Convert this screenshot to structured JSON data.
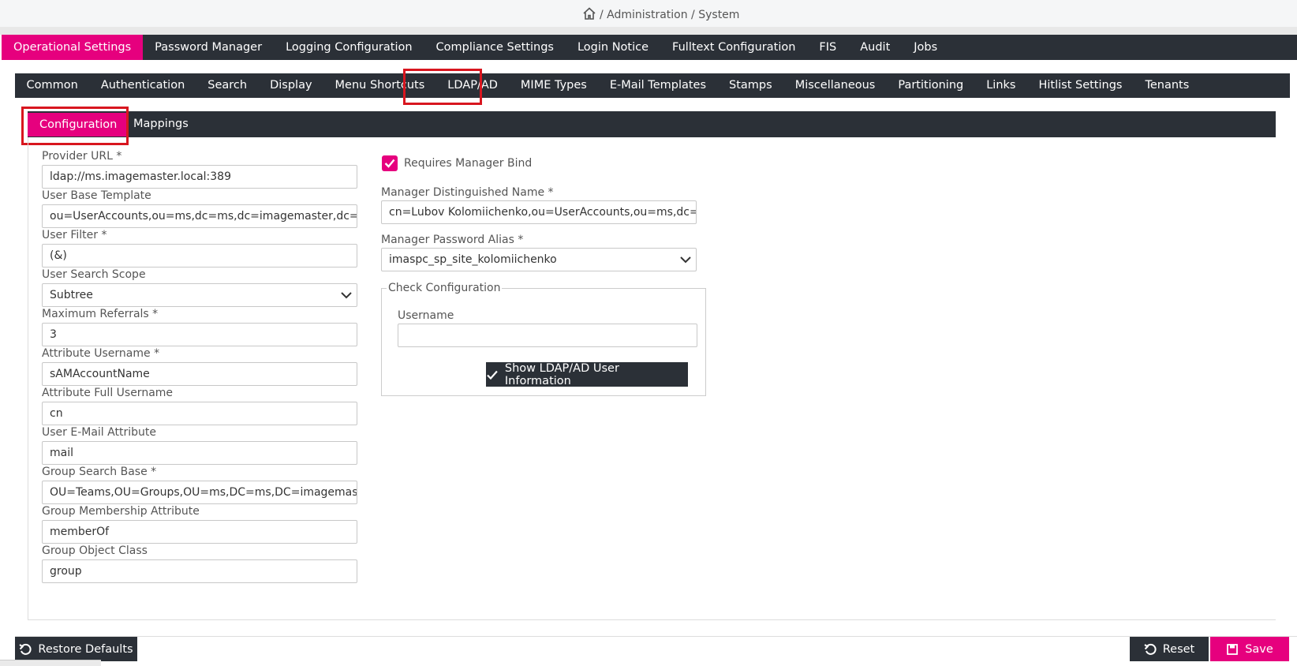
{
  "breadcrumb": {
    "text": "/ Administration / System"
  },
  "nav1": {
    "items": [
      "Operational Settings",
      "Password Manager",
      "Logging Configuration",
      "Compliance Settings",
      "Login Notice",
      "Fulltext Configuration",
      "FIS",
      "Audit",
      "Jobs"
    ]
  },
  "nav2": {
    "items": [
      "Common",
      "Authentication",
      "Search",
      "Display",
      "Menu Shortcuts",
      "LDAP/AD",
      "MIME Types",
      "E-Mail Templates",
      "Stamps",
      "Miscellaneous",
      "Partitioning",
      "Links",
      "Hitlist Settings",
      "Tenants"
    ]
  },
  "nav3": {
    "configuration": "Configuration",
    "mappings": "Mappings"
  },
  "form": {
    "provider_url": {
      "label": "Provider URL  *",
      "value": "ldap://ms.imagemaster.local:389"
    },
    "user_base_template": {
      "label": "User Base Template",
      "value": "ou=UserAccounts,ou=ms,dc=ms,dc=imagemaster,dc=local"
    },
    "user_filter": {
      "label": "User Filter  *",
      "value": "(&)"
    },
    "user_search_scope": {
      "label": "User Search Scope",
      "value": "Subtree"
    },
    "maximum_referrals": {
      "label": "Maximum Referrals  *",
      "value": "3"
    },
    "attribute_username": {
      "label": "Attribute Username  *",
      "value": "sAMAccountName"
    },
    "attribute_full_username": {
      "label": "Attribute Full Username",
      "value": "cn"
    },
    "user_email_attribute": {
      "label": "User E-Mail Attribute",
      "value": "mail"
    },
    "group_search_base": {
      "label": "Group Search Base  *",
      "value": "OU=Teams,OU=Groups,OU=ms,DC=ms,DC=imagemaster,DC"
    },
    "group_membership_attribute": {
      "label": "Group Membership Attribute",
      "value": "memberOf"
    },
    "group_object_class": {
      "label": "Group Object Class",
      "value": "group"
    }
  },
  "right": {
    "requires_manager_bind": {
      "label": "Requires Manager Bind",
      "checked": true
    },
    "manager_dn": {
      "label": "Manager Distinguished Name  *",
      "value": "cn=Lubov Kolomiichenko,ou=UserAccounts,ou=ms,dc=ms,dc"
    },
    "manager_password_alias": {
      "label": "Manager Password Alias  *",
      "value": "imaspc_sp_site_kolomiichenko"
    },
    "check_configuration": {
      "legend": "Check Configuration",
      "username_label": "Username",
      "username_value": "",
      "show_button": "Show LDAP/AD User Information"
    }
  },
  "footer": {
    "restore_defaults": "Restore Defaults",
    "reset": "Reset",
    "save": "Save"
  },
  "colors": {
    "accent": "#e6007e",
    "nav_bg": "#2b3037",
    "highlight": "#d8161f"
  },
  "icons": [
    "home-icon",
    "chevron-down-icon",
    "checkmark-icon",
    "undo-icon",
    "save-icon"
  ]
}
